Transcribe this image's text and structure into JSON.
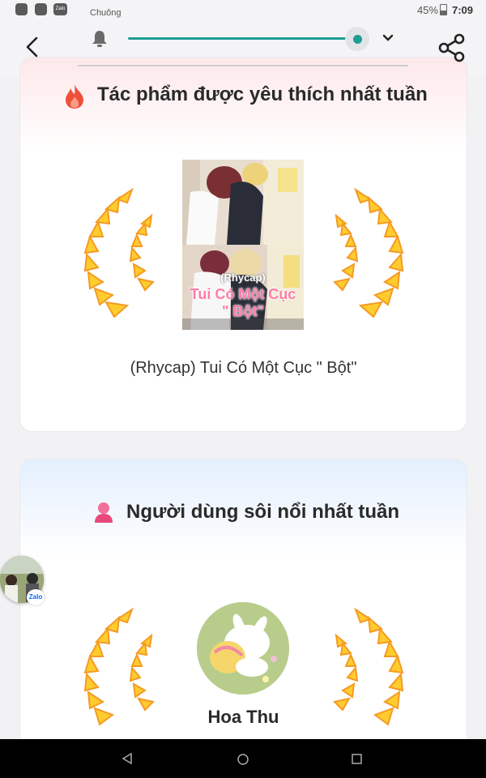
{
  "status_bar": {
    "volume_label": "Chuông",
    "battery": "45%",
    "time": "7:09",
    "zalo_label": "Zalo"
  },
  "volume": {
    "level": 0.95
  },
  "top_work": {
    "title": "Tác phẩm được yêu thích nhất tuần",
    "cover_caption_small": "(Rhycap)",
    "cover_caption_big": "Tui Có Một Cục \" Bột\"",
    "work_name": "(Rhycap) Tui Có Một Cục \" Bột\""
  },
  "top_user": {
    "title": "Người dùng sôi nổi nhất tuần",
    "user_name": "Hoa Thu"
  },
  "chat_bubble": {
    "badge": "Zalo"
  },
  "colors": {
    "accent": "#1f9c93",
    "fire": "#ef4f3a",
    "user_icon": "#e8497a",
    "laurel_light": "#ffd233",
    "laurel_dark": "#f58a1f"
  },
  "icons": [
    "back-arrow-icon",
    "bell-icon",
    "chevron-down-icon",
    "share-icon",
    "fire-icon",
    "user-icon",
    "nav-back-icon",
    "nav-home-icon",
    "nav-recents-icon"
  ]
}
